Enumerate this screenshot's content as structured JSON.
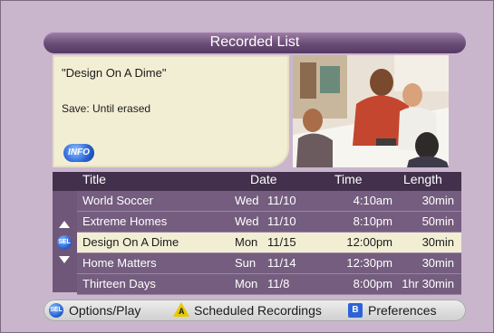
{
  "header": {
    "title": "Recorded List"
  },
  "info": {
    "show_title": "\"Design On A Dime\"",
    "save_text": "Save: Until erased",
    "info_button": "INFO"
  },
  "list": {
    "columns": {
      "title": "Title",
      "date": "Date",
      "time": "Time",
      "length": "Length"
    },
    "rows": [
      {
        "title": "World Soccer",
        "day": "Wed",
        "date": "11/10",
        "time": "4:10am",
        "length": "30min"
      },
      {
        "title": "Extreme Homes",
        "day": "Wed",
        "date": "11/10",
        "time": "8:10pm",
        "length": "50min"
      },
      {
        "title": "Design On A Dime",
        "day": "Mon",
        "date": "11/15",
        "time": "12:00pm",
        "length": "30min"
      },
      {
        "title": "Home Matters",
        "day": "Sun",
        "date": "11/14",
        "time": "12:30pm",
        "length": "30min"
      },
      {
        "title": "Thirteen Days",
        "day": "Mon",
        "date": "11/8",
        "time": "8:00pm",
        "length": "1hr 30min"
      }
    ],
    "selected_index": 2,
    "sel_label": "SEL"
  },
  "footer": {
    "sel_label": "SEL",
    "options_label": "Options/Play",
    "a_label": "A",
    "scheduled_label": "Scheduled Recordings",
    "b_label": "B",
    "preferences_label": "Preferences"
  },
  "colors": {
    "panel": "#c9b6cd",
    "list_bg": "#745d7f",
    "selected_row": "#f2eed4",
    "accent": "#2a64d6"
  }
}
